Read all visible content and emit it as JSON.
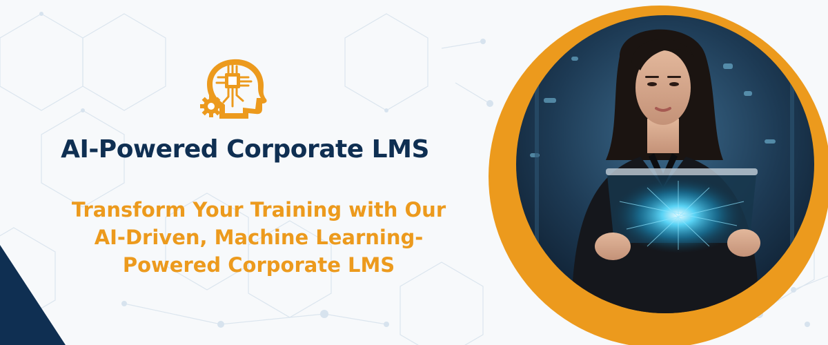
{
  "banner": {
    "title": "AI-Powered Corporate LMS",
    "subtitle_lines": [
      "Transform Your Training with Our",
      "AI-Driven, Machine Learning-",
      "Powered Corporate LMS"
    ],
    "logo_icon": "ai-head-chip-gear-icon",
    "photo": "woman-holding-holographic-tablet-image"
  },
  "colors": {
    "navy": "#0f2f52",
    "orange": "#ec9a1d",
    "background": "#f7f9fb"
  }
}
